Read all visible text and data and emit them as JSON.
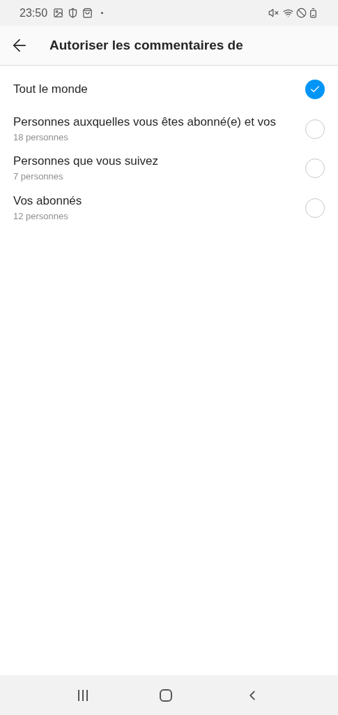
{
  "status_bar": {
    "time": "23:50"
  },
  "header": {
    "title": "Autoriser les commentaires de"
  },
  "options": [
    {
      "label": "Tout le monde",
      "selected": true
    },
    {
      "label": "Personnes auxquelles vous êtes abonné(e) et vos",
      "count": "18 personnes",
      "selected": false
    },
    {
      "label": "Personnes que vous suivez",
      "count": "7 personnes",
      "selected": false
    },
    {
      "label": "Vos abonnés",
      "count": "12 personnes",
      "selected": false
    }
  ]
}
